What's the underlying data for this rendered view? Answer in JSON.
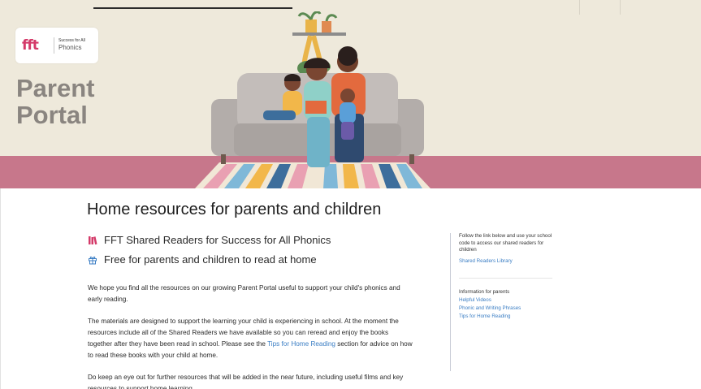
{
  "hero": {
    "logo": {
      "mark": "fft",
      "tagline": "Success for All",
      "name": "Phonics"
    },
    "portal_title_line1": "Parent",
    "portal_title_line2": "Portal"
  },
  "content": {
    "heading": "Home resources for parents and children",
    "features": [
      {
        "icon": "books-icon",
        "label": "FFT Shared Readers for Success for All Phonics"
      },
      {
        "icon": "gift-icon",
        "label": "Free for parents and children to read at home"
      }
    ],
    "para1": "We hope you find all the resources on our growing Parent Portal useful to support your child's phonics and early reading.",
    "para2_before": "The materials are designed to support the learning your child is experiencing in school. At the moment the resources include all of the Shared Readers we have available so you can reread and enjoy the books together after they have been read in school. Please see the ",
    "para2_link": "Tips for Home Reading",
    "para2_after": " section for advice on how to read these books with your child at home.",
    "para3": "Do keep an eye out for further resources that will be added in the near future, including useful films and key resources to support home learning."
  },
  "sidebar": {
    "intro": "Follow the link below and use your school code to access our shared readers for children",
    "library_link": "Shared Readers Library",
    "info_heading": "Information for parents",
    "links": [
      "Helpful Videos",
      "Phonic and Writing Phrases",
      "Tips for Home Reading"
    ]
  },
  "colors": {
    "hero_bg": "#eee9db",
    "band": "#c7778b",
    "brand_pink": "#d43a69",
    "link_blue": "#3b7ec4",
    "title_grey": "#8a8580"
  }
}
